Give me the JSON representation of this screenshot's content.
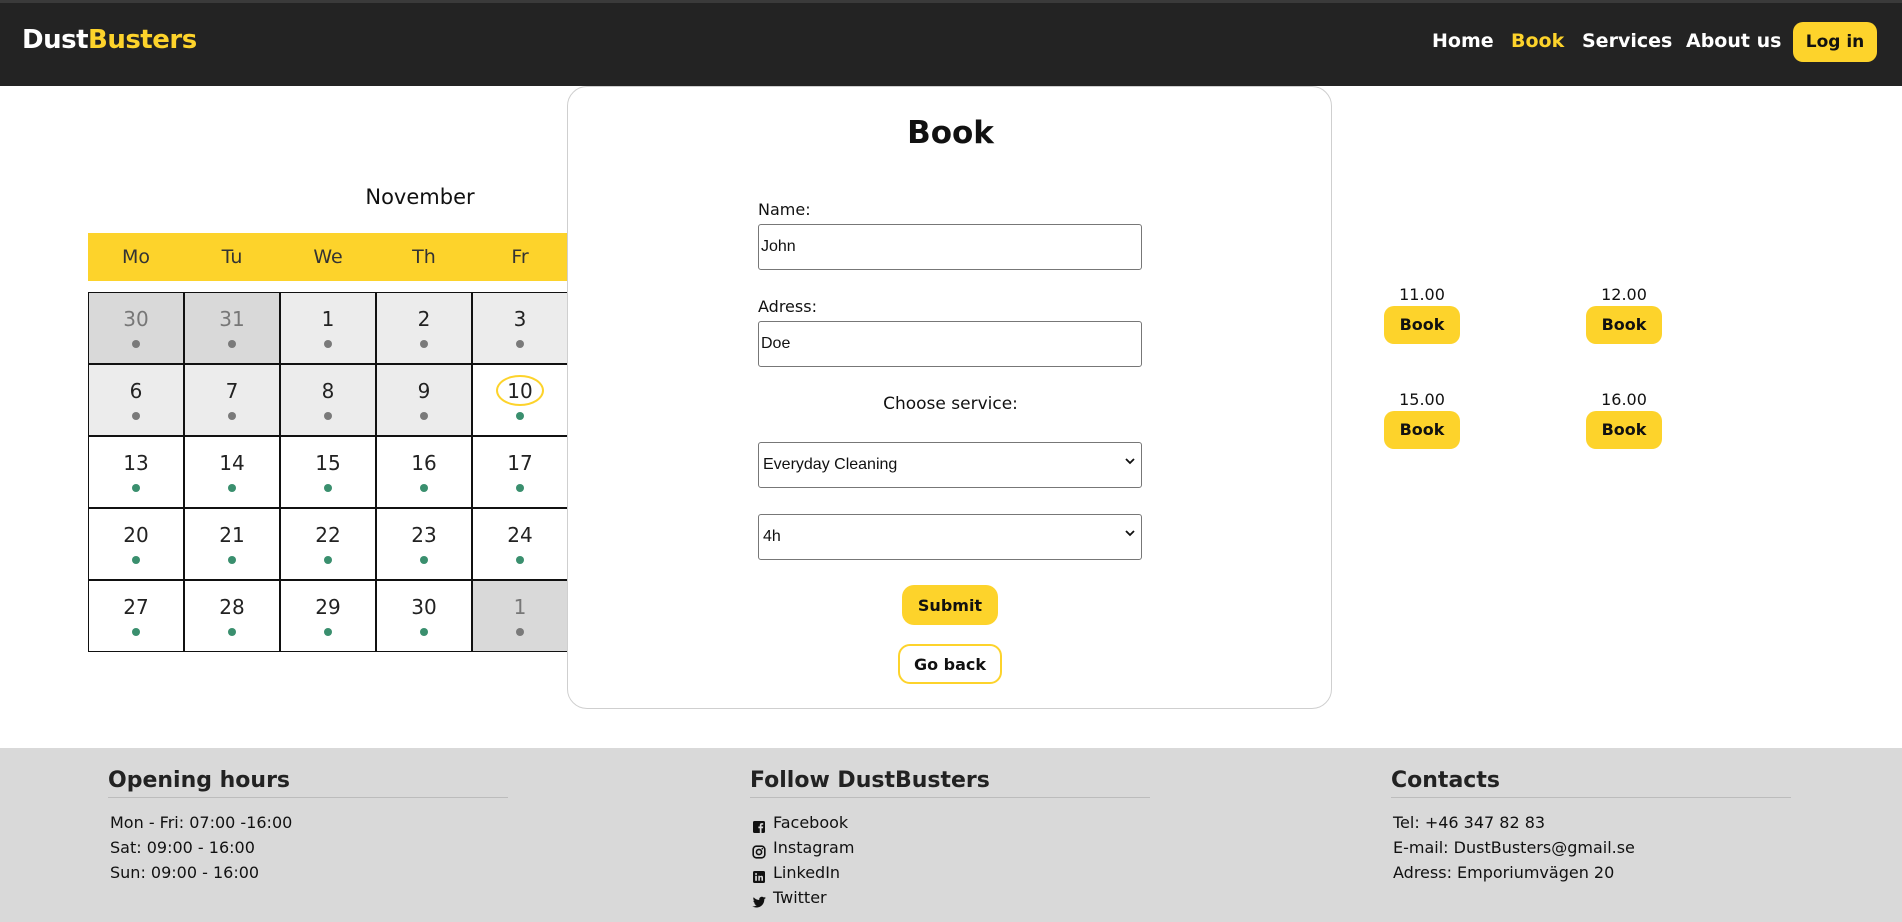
{
  "nav": {
    "logo_part1": "Dust",
    "logo_part2": "Busters",
    "links": [
      "Home",
      "Book",
      "Services",
      "About us"
    ],
    "active": "Book",
    "login": "Log in"
  },
  "calendar": {
    "month": "November",
    "weekdays": [
      "Mo",
      "Tu",
      "We",
      "Th",
      "Fr"
    ],
    "weeks": [
      [
        {
          "d": "30",
          "s": "prev"
        },
        {
          "d": "31",
          "s": "prev"
        },
        {
          "d": "1",
          "s": "past"
        },
        {
          "d": "2",
          "s": "past"
        },
        {
          "d": "3",
          "s": "past"
        }
      ],
      [
        {
          "d": "6",
          "s": "past"
        },
        {
          "d": "7",
          "s": "past"
        },
        {
          "d": "8",
          "s": "past"
        },
        {
          "d": "9",
          "s": "past"
        },
        {
          "d": "10",
          "s": "today"
        }
      ],
      [
        {
          "d": "13",
          "s": "open"
        },
        {
          "d": "14",
          "s": "open"
        },
        {
          "d": "15",
          "s": "open"
        },
        {
          "d": "16",
          "s": "open"
        },
        {
          "d": "17",
          "s": "open"
        }
      ],
      [
        {
          "d": "20",
          "s": "open"
        },
        {
          "d": "21",
          "s": "open"
        },
        {
          "d": "22",
          "s": "open"
        },
        {
          "d": "23",
          "s": "open"
        },
        {
          "d": "24",
          "s": "open"
        }
      ],
      [
        {
          "d": "27",
          "s": "open"
        },
        {
          "d": "28",
          "s": "open"
        },
        {
          "d": "29",
          "s": "open"
        },
        {
          "d": "30",
          "s": "open"
        },
        {
          "d": "1",
          "s": "prev"
        }
      ]
    ]
  },
  "slots": [
    {
      "time": "11.00",
      "label": "Book"
    },
    {
      "time": "12.00",
      "label": "Book"
    },
    {
      "time": "15.00",
      "label": "Book"
    },
    {
      "time": "16.00",
      "label": "Book"
    }
  ],
  "modal": {
    "title": "Book",
    "name_label": "Name:",
    "name_value": "John",
    "address_label": "Adress:",
    "address_value": "Doe",
    "choose_label": "Choose service:",
    "service_selected": "Everyday Cleaning",
    "duration_selected": "4h",
    "submit": "Submit",
    "back": "Go back"
  },
  "footer": {
    "hours_title": "Opening hours",
    "hours": [
      "Mon - Fri: 07:00 -16:00",
      "Sat: 09:00 - 16:00",
      "Sun: 09:00 - 16:00"
    ],
    "follow_title": "Follow DustBusters",
    "social": [
      {
        "label": "Facebook",
        "icon": "facebook-icon"
      },
      {
        "label": "Instagram",
        "icon": "instagram-icon"
      },
      {
        "label": "LinkedIn",
        "icon": "linkedin-icon"
      },
      {
        "label": "Twitter",
        "icon": "twitter-icon"
      }
    ],
    "contacts_title": "Contacts",
    "contacts": [
      "Tel: +46 347 82 83",
      "E-mail: DustBusters@gmail.se",
      "Adress: Emporiumvägen 20"
    ]
  },
  "colors": {
    "accent": "#fdd32b",
    "nav_bg": "#232323",
    "available_dot": "#3a8f6e",
    "footer_bg": "#d9d9d9"
  }
}
